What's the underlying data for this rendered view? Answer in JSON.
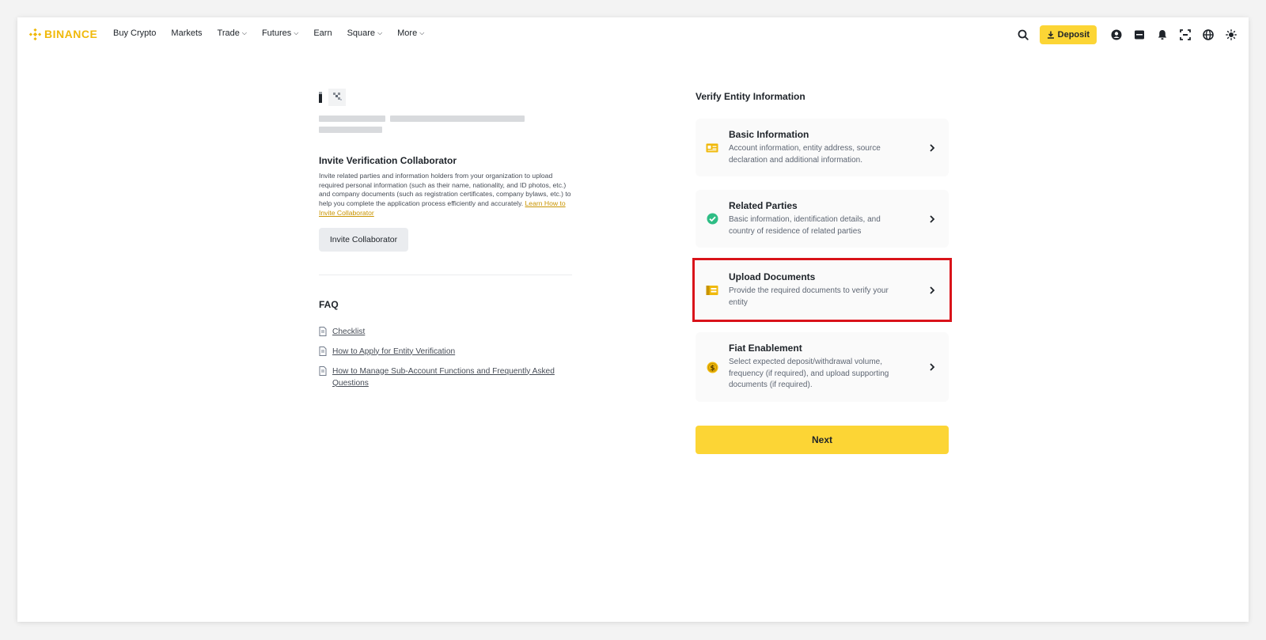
{
  "nav": {
    "brand": "BINANCE",
    "links": [
      {
        "label": "Buy Crypto",
        "dropdown": false
      },
      {
        "label": "Markets",
        "dropdown": false
      },
      {
        "label": "Trade",
        "dropdown": true
      },
      {
        "label": "Futures",
        "dropdown": true
      },
      {
        "label": "Earn",
        "dropdown": false
      },
      {
        "label": "Square",
        "dropdown": true
      },
      {
        "label": "More",
        "dropdown": true
      }
    ],
    "deposit_label": "Deposit",
    "icons": [
      "search-icon",
      "download-icon",
      "user-icon",
      "wallet-icon",
      "bell-icon",
      "scan-icon",
      "globe-icon",
      "theme-icon"
    ]
  },
  "left": {
    "invite_title": "Invite Verification Collaborator",
    "invite_desc": "Invite related parties and information holders from your organization to upload required personal information (such as their name, nationality, and ID photos, etc.) and company documents (such as registration certificates, company bylaws, etc.) to help you complete the application process efficiently and accurately.",
    "invite_link": "Learn How to Invite Collaborator",
    "invite_button": "Invite Collaborator",
    "faq_title": "FAQ",
    "faq_items": [
      "Checklist",
      "How to Apply for Entity Verification",
      "How to Manage Sub-Account Functions and Frequently Asked Questions"
    ]
  },
  "right": {
    "title": "Verify Entity Information",
    "cards": [
      {
        "title": "Basic Information",
        "subtitle": "Account information, entity address, source declaration and additional information."
      },
      {
        "title": "Related Parties",
        "subtitle": "Basic information, identification details, and country of residence of related parties"
      },
      {
        "title": "Upload Documents",
        "subtitle": "Provide the required documents to verify your entity"
      },
      {
        "title": "Fiat Enablement",
        "subtitle": "Select expected deposit/withdrawal volume, frequency (if required), and upload supporting documents (if required)."
      }
    ],
    "next_button": "Next"
  },
  "colors": {
    "brand": "#f0b90b",
    "button_yellow": "#fcd535",
    "highlight_red": "#d9131a",
    "success_green": "#2ebd85"
  }
}
